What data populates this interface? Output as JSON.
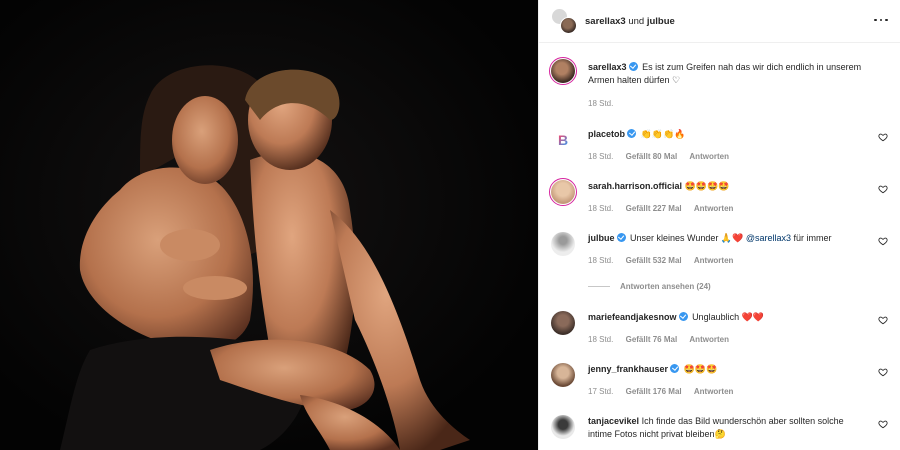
{
  "header": {
    "user1": "sarellax3",
    "connector": "und",
    "user2": "julbue",
    "more_icon": "more-horizontal-icon"
  },
  "caption": {
    "user": "sarellax3",
    "text": "Es ist zum Greifen nah das wir dich endlich in unserem Armen halten dürfen ♡",
    "time": "18 Std."
  },
  "comments": [
    {
      "user": "placetob",
      "verified": true,
      "text": "👏👏👏🔥",
      "time": "18 Std.",
      "likes": "Gefällt 80 Mal",
      "reply": "Antworten"
    },
    {
      "user": "sarah.harrison.official",
      "verified": false,
      "text": "🤩🤩🤩🤩",
      "time": "18 Std.",
      "likes": "Gefällt 227 Mal",
      "reply": "Antworten"
    },
    {
      "user": "julbue",
      "verified": true,
      "text_before": "Unser kleines Wunder 🙏❤️",
      "mention": "@sarellax3",
      "text_after": "für immer",
      "time": "18 Std.",
      "likes": "Gefällt 532 Mal",
      "reply": "Antworten"
    },
    {
      "user": "mariefeandjakesnow",
      "verified": true,
      "text": "Unglaublich ❤️❤️",
      "time": "18 Std.",
      "likes": "Gefällt 76 Mal",
      "reply": "Antworten"
    },
    {
      "user": "jenny_frankhauser",
      "verified": true,
      "text": "🤩🤩🤩",
      "time": "17 Std.",
      "likes": "Gefällt 176 Mal",
      "reply": "Antworten"
    },
    {
      "user": "tanjacevikel",
      "verified": false,
      "text": "Ich finde das Bild wunderschön aber sollten solche intime Fotos nicht privat bleiben🤔"
    }
  ],
  "view_replies": "Antworten ansehen (24)"
}
